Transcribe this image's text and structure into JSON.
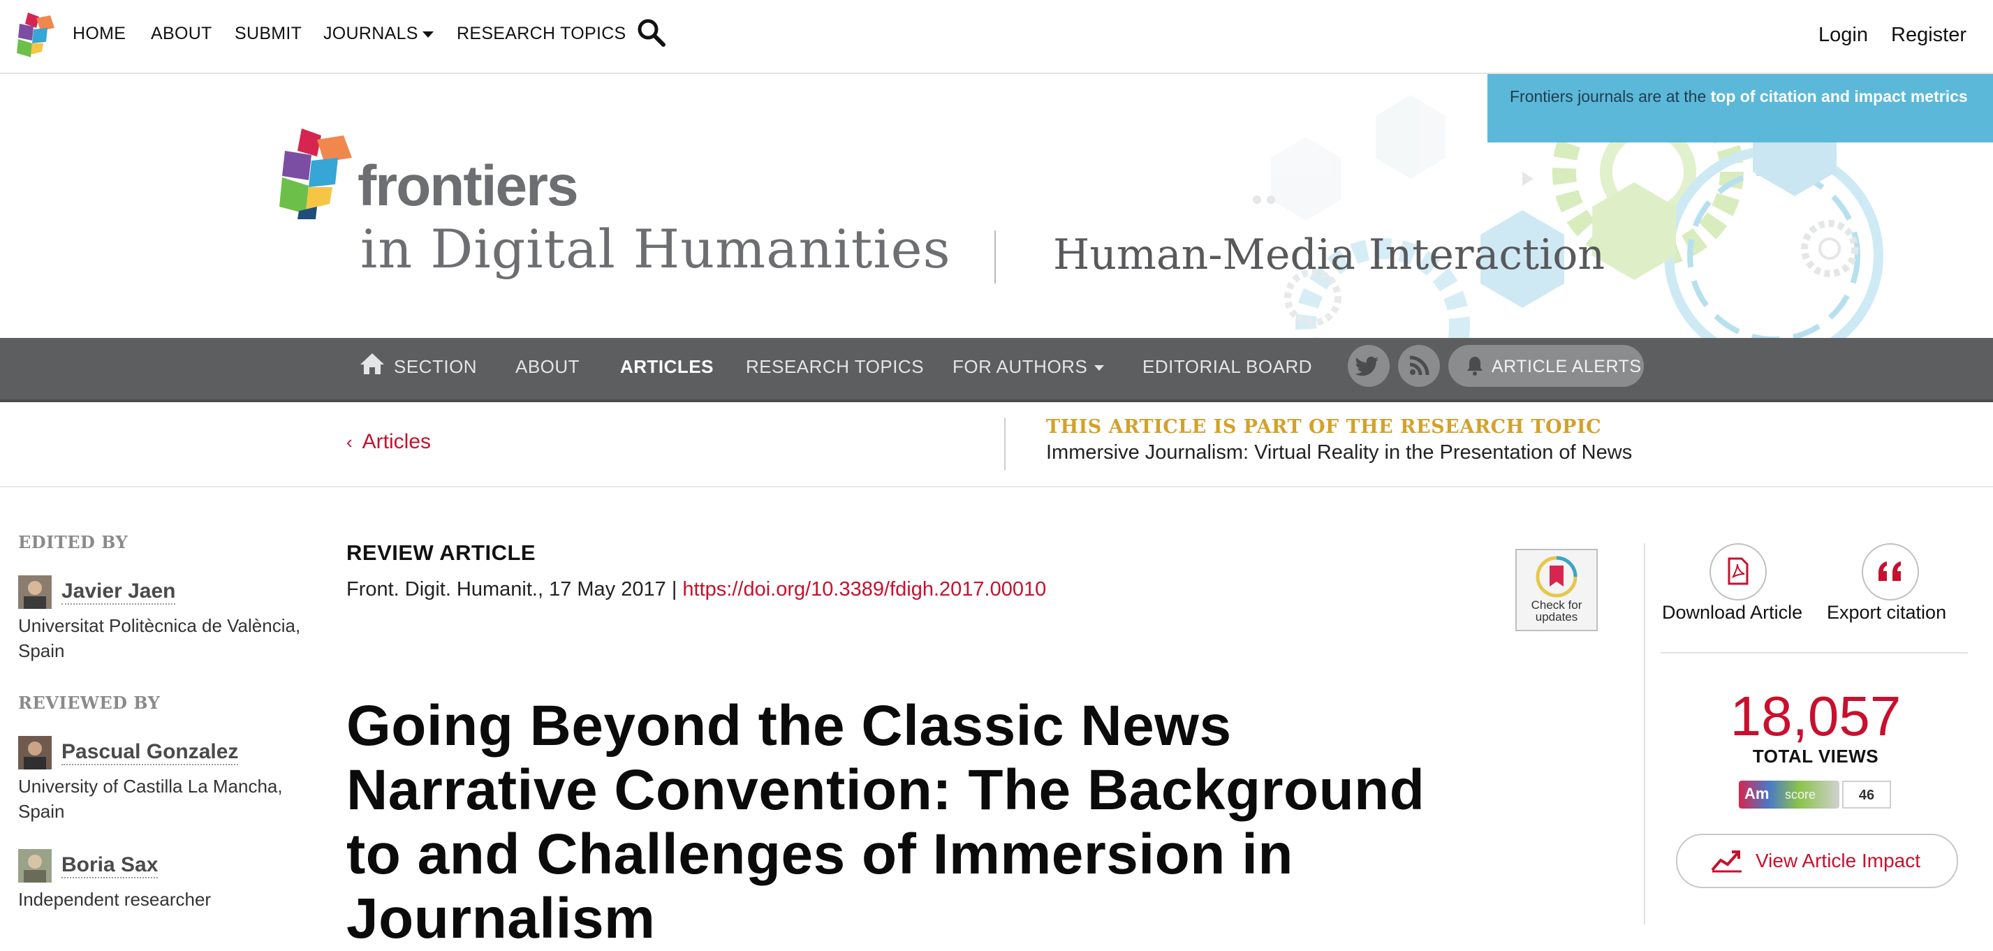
{
  "topnav": {
    "items": [
      "HOME",
      "ABOUT",
      "SUBMIT",
      "JOURNALS",
      "RESEARCH TOPICS"
    ],
    "login": "Login",
    "register": "Register"
  },
  "header": {
    "brand": "frontiers",
    "journal": "in Digital Humanities",
    "section": "Human-Media Interaction",
    "promo_text": "Frontiers journals are at the ",
    "promo_link": "top of citation and impact metrics"
  },
  "secnav": {
    "items": [
      "SECTION",
      "ABOUT",
      "ARTICLES",
      "RESEARCH TOPICS",
      "FOR AUTHORS",
      "EDITORIAL BOARD"
    ],
    "active": "ARTICLES",
    "alerts": "ARTICLE ALERTS"
  },
  "crumb": {
    "back": "Articles",
    "topic_label": "THIS ARTICLE IS PART OF THE RESEARCH TOPIC",
    "topic_title": "Immersive Journalism: Virtual Reality in the Presentation of News"
  },
  "sidebar": {
    "edited_by": "EDITED BY",
    "reviewed_by": "REVIEWED BY",
    "editors": [
      {
        "name": "Javier Jaen",
        "affiliation": "Universitat Politècnica de València, Spain"
      }
    ],
    "reviewers": [
      {
        "name": "Pascual Gonzalez",
        "affiliation": "University of Castilla La Mancha, Spain"
      },
      {
        "name": "Boria Sax",
        "affiliation": "Independent researcher"
      }
    ]
  },
  "article": {
    "type": "REVIEW ARTICLE",
    "citation": "Front. Digit. Humanit., 17 May 2017 | ",
    "doi": "https://doi.org/10.3389/fdigh.2017.00010",
    "check_badge": [
      "Check for",
      "updates"
    ],
    "title": "Going Beyond the Classic News Narrative Convention: The Background to and Challenges of Immersion in Journalism"
  },
  "actions": {
    "download": "Download Article",
    "export": "Export citation",
    "views": "18,057",
    "views_label": "TOTAL VIEWS",
    "altmetric_am": "Am",
    "altmetric_score_label": "score",
    "altmetric_score": "46",
    "impact": "View Article Impact"
  },
  "colors": {
    "brand_red": "#c8102e",
    "topic_gold": "#d4a12a",
    "nav_gray": "#5d5e60",
    "promo_blue": "#5bb8d9"
  }
}
